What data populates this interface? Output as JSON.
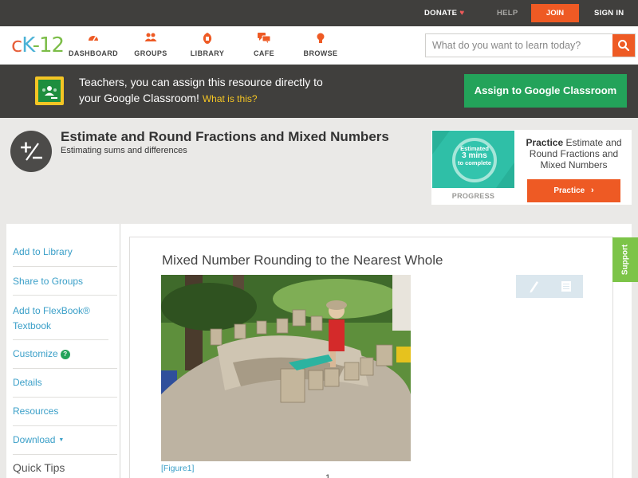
{
  "topbar": {
    "donate": "DONATE",
    "help": "HELP",
    "join": "JOIN",
    "signin": "SIGN IN"
  },
  "logo": {
    "part1": "c",
    "part2": "K",
    "part3": "-12"
  },
  "nav": {
    "items": [
      {
        "label": "DASHBOARD",
        "icon": "dashboard-icon"
      },
      {
        "label": "GROUPS",
        "icon": "groups-icon"
      },
      {
        "label": "LIBRARY",
        "icon": "library-icon"
      },
      {
        "label": "CAFE",
        "icon": "cafe-icon"
      },
      {
        "label": "BROWSE",
        "icon": "browse-icon"
      }
    ]
  },
  "search": {
    "placeholder": "What do you want to learn today?"
  },
  "banner": {
    "text_line1": "Teachers, you can assign this resource directly to",
    "text_line2": "your Google Classroom!",
    "what_link": "What is this?",
    "assign_button": "Assign to Google Classroom"
  },
  "concept": {
    "title": "Estimate and Round Fractions and Mixed Numbers",
    "subtitle": "Estimating sums and differences"
  },
  "practice_card": {
    "estimated": "Estimated",
    "minutes": "3 mins",
    "to_complete": "to complete",
    "progress_label": "PROGRESS",
    "practice_bold": "Practice",
    "practice_text": "Estimate and Round Fractions and Mixed Numbers",
    "practice_button": "Practice"
  },
  "sidebar": {
    "items": [
      {
        "label": "Add to Library"
      },
      {
        "label": "Share to Groups"
      },
      {
        "label": "Add to FlexBook® Textbook"
      },
      {
        "label": "Customize"
      },
      {
        "label": "Details"
      },
      {
        "label": "Resources"
      },
      {
        "label": "Download"
      }
    ],
    "customize_badge": "?",
    "quick_tips": "Quick Tips"
  },
  "content": {
    "section_title": "Mixed Number Rounding to the Nearest Whole",
    "figure_caption": "[Figure1]",
    "math_fragment": "1"
  },
  "support_tab": "Support",
  "colors": {
    "brand_orange": "#ee5a24",
    "google_green": "#23a35a",
    "link_blue": "#3a9fc8",
    "dark_bar": "#403f3d",
    "support_green": "#7cc448"
  }
}
